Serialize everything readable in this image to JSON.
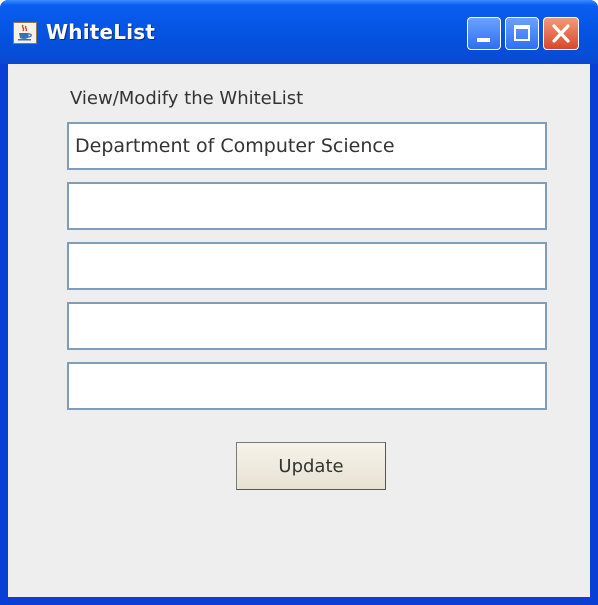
{
  "window": {
    "title": "WhiteList",
    "icon": "java-coffee-cup-icon"
  },
  "title_buttons": {
    "minimize": "minimize-icon",
    "maximize": "maximize-icon",
    "close": "close-icon"
  },
  "main": {
    "heading": "View/Modify the WhiteList",
    "fields": [
      "Department of Computer Science",
      "",
      "",
      "",
      ""
    ],
    "update_label": "Update"
  },
  "colors": {
    "titlebar": "#0656e6",
    "client_background": "#eeeeee",
    "field_border": "#7f9db9",
    "close_button": "#d9472a"
  }
}
